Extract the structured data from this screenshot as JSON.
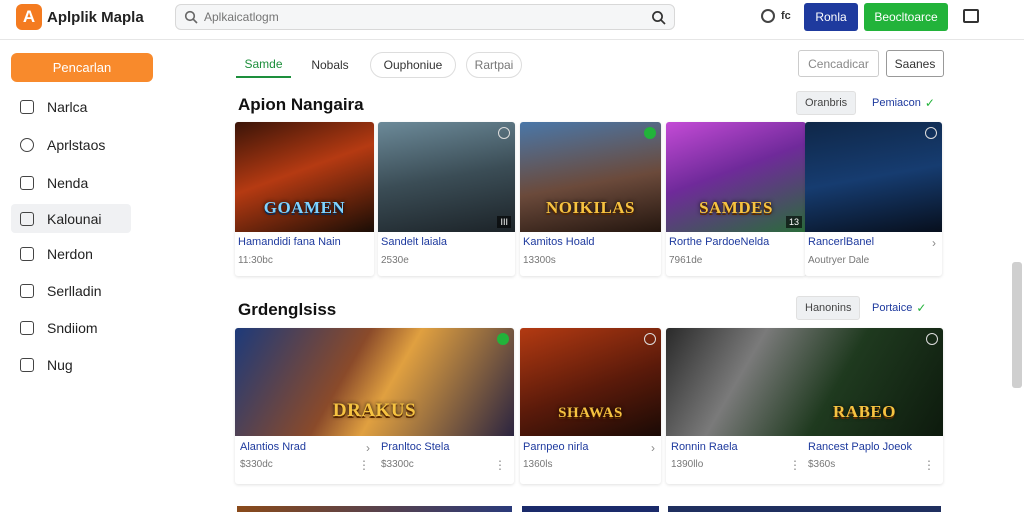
{
  "header": {
    "logo_letter": "A",
    "app_title": "Aplplik Mapla",
    "search_placeholder": "Aplkaicatlogm",
    "small_label": "fc",
    "blue_button": "Ronla",
    "green_button": "Beocltoarce"
  },
  "sidebar": {
    "primary_button": "Pencarlan",
    "items": [
      {
        "label": "Narlca",
        "icon": "home-icon"
      },
      {
        "label": "Aprlstaos",
        "icon": "user-icon"
      },
      {
        "label": "Nenda",
        "icon": "bookmark-icon"
      },
      {
        "label": "Kalounai",
        "icon": "image-icon"
      },
      {
        "label": "Nerdon",
        "icon": "grid-icon"
      },
      {
        "label": "Serlladin",
        "icon": "lock-icon"
      },
      {
        "label": "Sndiiom",
        "icon": "calendar-icon"
      },
      {
        "label": "Nug",
        "icon": "chart-icon"
      }
    ]
  },
  "tabs": [
    {
      "label": "Samde"
    },
    {
      "label": "Nobals"
    },
    {
      "label": "Ouphoniue"
    },
    {
      "label": "Rartpai"
    }
  ],
  "tabs_right": {
    "cancel": "Cencadicar",
    "save": "Saanes"
  },
  "sections": [
    {
      "title": "Apion Nangaira",
      "gray_button": "Oranbris",
      "link_button": "Pemiacon",
      "tiles": [
        {
          "title": "Hamandidi fana Nain",
          "sub": "11:30bc",
          "art_label": "GOAMEN"
        },
        {
          "title": "Sandelt laiala",
          "sub": "2530e",
          "corner": "III"
        },
        {
          "title": "Kamitos Hoald",
          "sub": "13300s",
          "art_label": "NOIKILAS"
        },
        {
          "title": "Rorthe PardoeNelda",
          "sub": "7961de",
          "art_label": "SAMDES",
          "corner": "13"
        },
        {
          "title": "RancerlBanel",
          "sub": "Aoutryer Dale"
        }
      ]
    },
    {
      "title": "Grdenglsiss",
      "gray_button": "Hanonins",
      "link_button": "Portaice",
      "tiles": [
        {
          "title": "Alantios Nrad",
          "sub": "$330dc",
          "art_label": "DRAKUS"
        },
        {
          "title": "Pranltoc Stela",
          "sub": "$3300c"
        },
        {
          "title": "Parnpeo nirla",
          "sub": "1360ls",
          "art_label": "SHAWAS"
        },
        {
          "title": "Ronnin Raela",
          "sub": "1390llo"
        },
        {
          "title": "Rancest Paplo Joeok",
          "sub": "$360s",
          "art_label": "RABEO"
        }
      ]
    }
  ],
  "colors": {
    "accent_orange": "#f88a2c",
    "brand_blue": "#1e3a9e",
    "brand_green": "#22b33a"
  }
}
